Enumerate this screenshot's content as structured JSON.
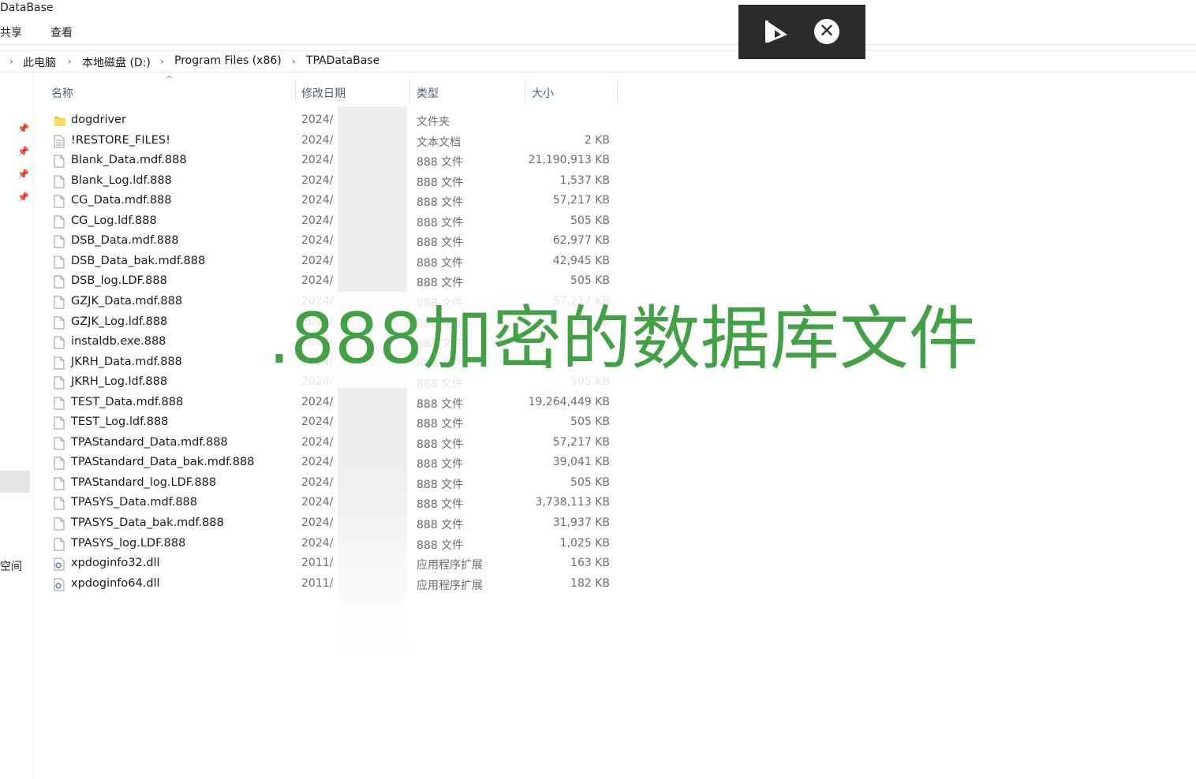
{
  "window": {
    "title": "DataBase"
  },
  "menu": {
    "share": "共享",
    "view": "查看"
  },
  "breadcrumb": {
    "items": [
      "此电脑",
      "本地磁盘 (D:)",
      "Program Files (x86)",
      "TPADataBase"
    ],
    "separator": "›"
  },
  "left_pane": {
    "partial_label": "空间"
  },
  "columns": {
    "name": "名称",
    "date": "修改日期",
    "type": "类型",
    "size": "大小"
  },
  "files": [
    {
      "name": "dogdriver",
      "date": "2024/",
      "type": "文件夹",
      "size": "",
      "icon": "folder-icon"
    },
    {
      "name": "!RESTORE_FILES!",
      "date": "2024/",
      "type": "文本文档",
      "size": "2 KB",
      "icon": "text-file-icon"
    },
    {
      "name": "Blank_Data.mdf.888",
      "date": "2024/",
      "type": "888 文件",
      "size": "21,190,913 KB",
      "icon": "file-icon"
    },
    {
      "name": "Blank_Log.ldf.888",
      "date": "2024/",
      "type": "888 文件",
      "size": "1,537 KB",
      "icon": "file-icon"
    },
    {
      "name": "CG_Data.mdf.888",
      "date": "2024/",
      "type": "888 文件",
      "size": "57,217 KB",
      "icon": "file-icon"
    },
    {
      "name": "CG_Log.ldf.888",
      "date": "2024/",
      "type": "888 文件",
      "size": "505 KB",
      "icon": "file-icon"
    },
    {
      "name": "DSB_Data.mdf.888",
      "date": "2024/",
      "type": "888 文件",
      "size": "62,977 KB",
      "icon": "file-icon"
    },
    {
      "name": "DSB_Data_bak.mdf.888",
      "date": "2024/",
      "type": "888 文件",
      "size": "42,945 KB",
      "icon": "file-icon"
    },
    {
      "name": "DSB_log.LDF.888",
      "date": "2024/",
      "type": "888 文件",
      "size": "505 KB",
      "icon": "file-icon"
    },
    {
      "name": "GZJK_Data.mdf.888",
      "date": "2024/",
      "type": "888 文件",
      "size": "57,217 KB",
      "icon": "file-icon"
    },
    {
      "name": "GZJK_Log.ldf.888",
      "date": "2024/",
      "type": "888 文件",
      "size": "505 KB",
      "icon": "file-icon"
    },
    {
      "name": "instaldb.exe.888",
      "date": "2024/",
      "type": "888 文件",
      "size": "",
      "icon": "file-icon"
    },
    {
      "name": "JKRH_Data.mdf.888",
      "date": "2024/",
      "type": "888 文件",
      "size": "",
      "icon": "file-icon"
    },
    {
      "name": "JKRH_Log.ldf.888",
      "date": "2024/",
      "type": "888 文件",
      "size": "505 KB",
      "icon": "file-icon"
    },
    {
      "name": "TEST_Data.mdf.888",
      "date": "2024/",
      "type": "888 文件",
      "size": "19,264,449 KB",
      "icon": "file-icon"
    },
    {
      "name": "TEST_Log.ldf.888",
      "date": "2024/",
      "type": "888 文件",
      "size": "505 KB",
      "icon": "file-icon"
    },
    {
      "name": "TPAStandard_Data.mdf.888",
      "date": "2024/",
      "type": "888 文件",
      "size": "57,217 KB",
      "icon": "file-icon"
    },
    {
      "name": "TPAStandard_Data_bak.mdf.888",
      "date": "2024/",
      "type": "888 文件",
      "size": "39,041 KB",
      "icon": "file-icon"
    },
    {
      "name": "TPAStandard_log.LDF.888",
      "date": "2024/",
      "type": "888 文件",
      "size": "505 KB",
      "icon": "file-icon"
    },
    {
      "name": "TPASYS_Data.mdf.888",
      "date": "2024/",
      "type": "888 文件",
      "size": "3,738,113 KB",
      "icon": "file-icon"
    },
    {
      "name": "TPASYS_Data_bak.mdf.888",
      "date": "2024/",
      "type": "888 文件",
      "size": "31,937 KB",
      "icon": "file-icon"
    },
    {
      "name": "TPASYS_log.LDF.888",
      "date": "2024/",
      "type": "888 文件",
      "size": "1,025 KB",
      "icon": "file-icon"
    },
    {
      "name": "xpdoginfo32.dll",
      "date": "2011/",
      "type": "应用程序扩展",
      "size": "163 KB",
      "icon": "dll-file-icon"
    },
    {
      "name": "xpdoginfo64.dll",
      "date": "2011/",
      "type": "应用程序扩展",
      "size": "182 KB",
      "icon": "dll-file-icon"
    }
  ],
  "caption": {
    "text": ".888加密的数据库文件",
    "color": "#43a047"
  },
  "overlay": {
    "play_icon": "play-icon",
    "close_icon": "close-circle-icon"
  }
}
